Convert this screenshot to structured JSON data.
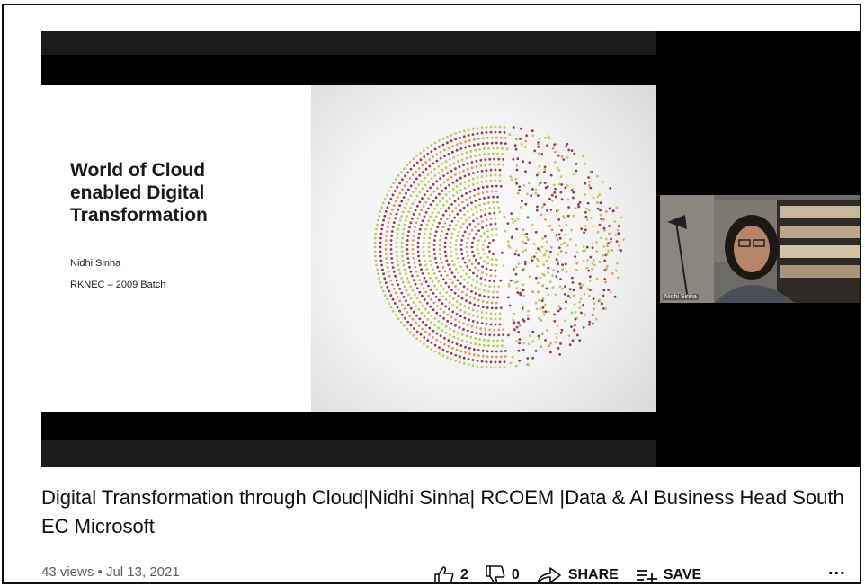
{
  "slide": {
    "title": "World of Cloud\nenabled Digital\nTransformation",
    "presenter": "Nidhi Sinha",
    "batch": "RKNEC – 2009 Batch"
  },
  "webcam": {
    "name_tag": "Nidhi Sinha"
  },
  "video": {
    "title": "Digital Transformation through Cloud|Nidhi Sinha| RCOEM |Data & AI Business Head South EC Microsoft",
    "views": "43 views",
    "separator": "•",
    "date": "Jul 13, 2021"
  },
  "actions": {
    "like_count": "2",
    "dislike_count": "0",
    "share_label": "SHARE",
    "save_label": "SAVE",
    "more_label": "..."
  },
  "icons": {
    "like": "thumbs-up-icon",
    "dislike": "thumbs-down-icon",
    "share": "share-arrow-icon",
    "save": "playlist-add-icon",
    "more": "more-horizontal-icon"
  },
  "colors": {
    "dot_green": "#b7cf5e",
    "dot_maroon": "#9b3a5a",
    "dot_orange": "#d9a25a"
  }
}
